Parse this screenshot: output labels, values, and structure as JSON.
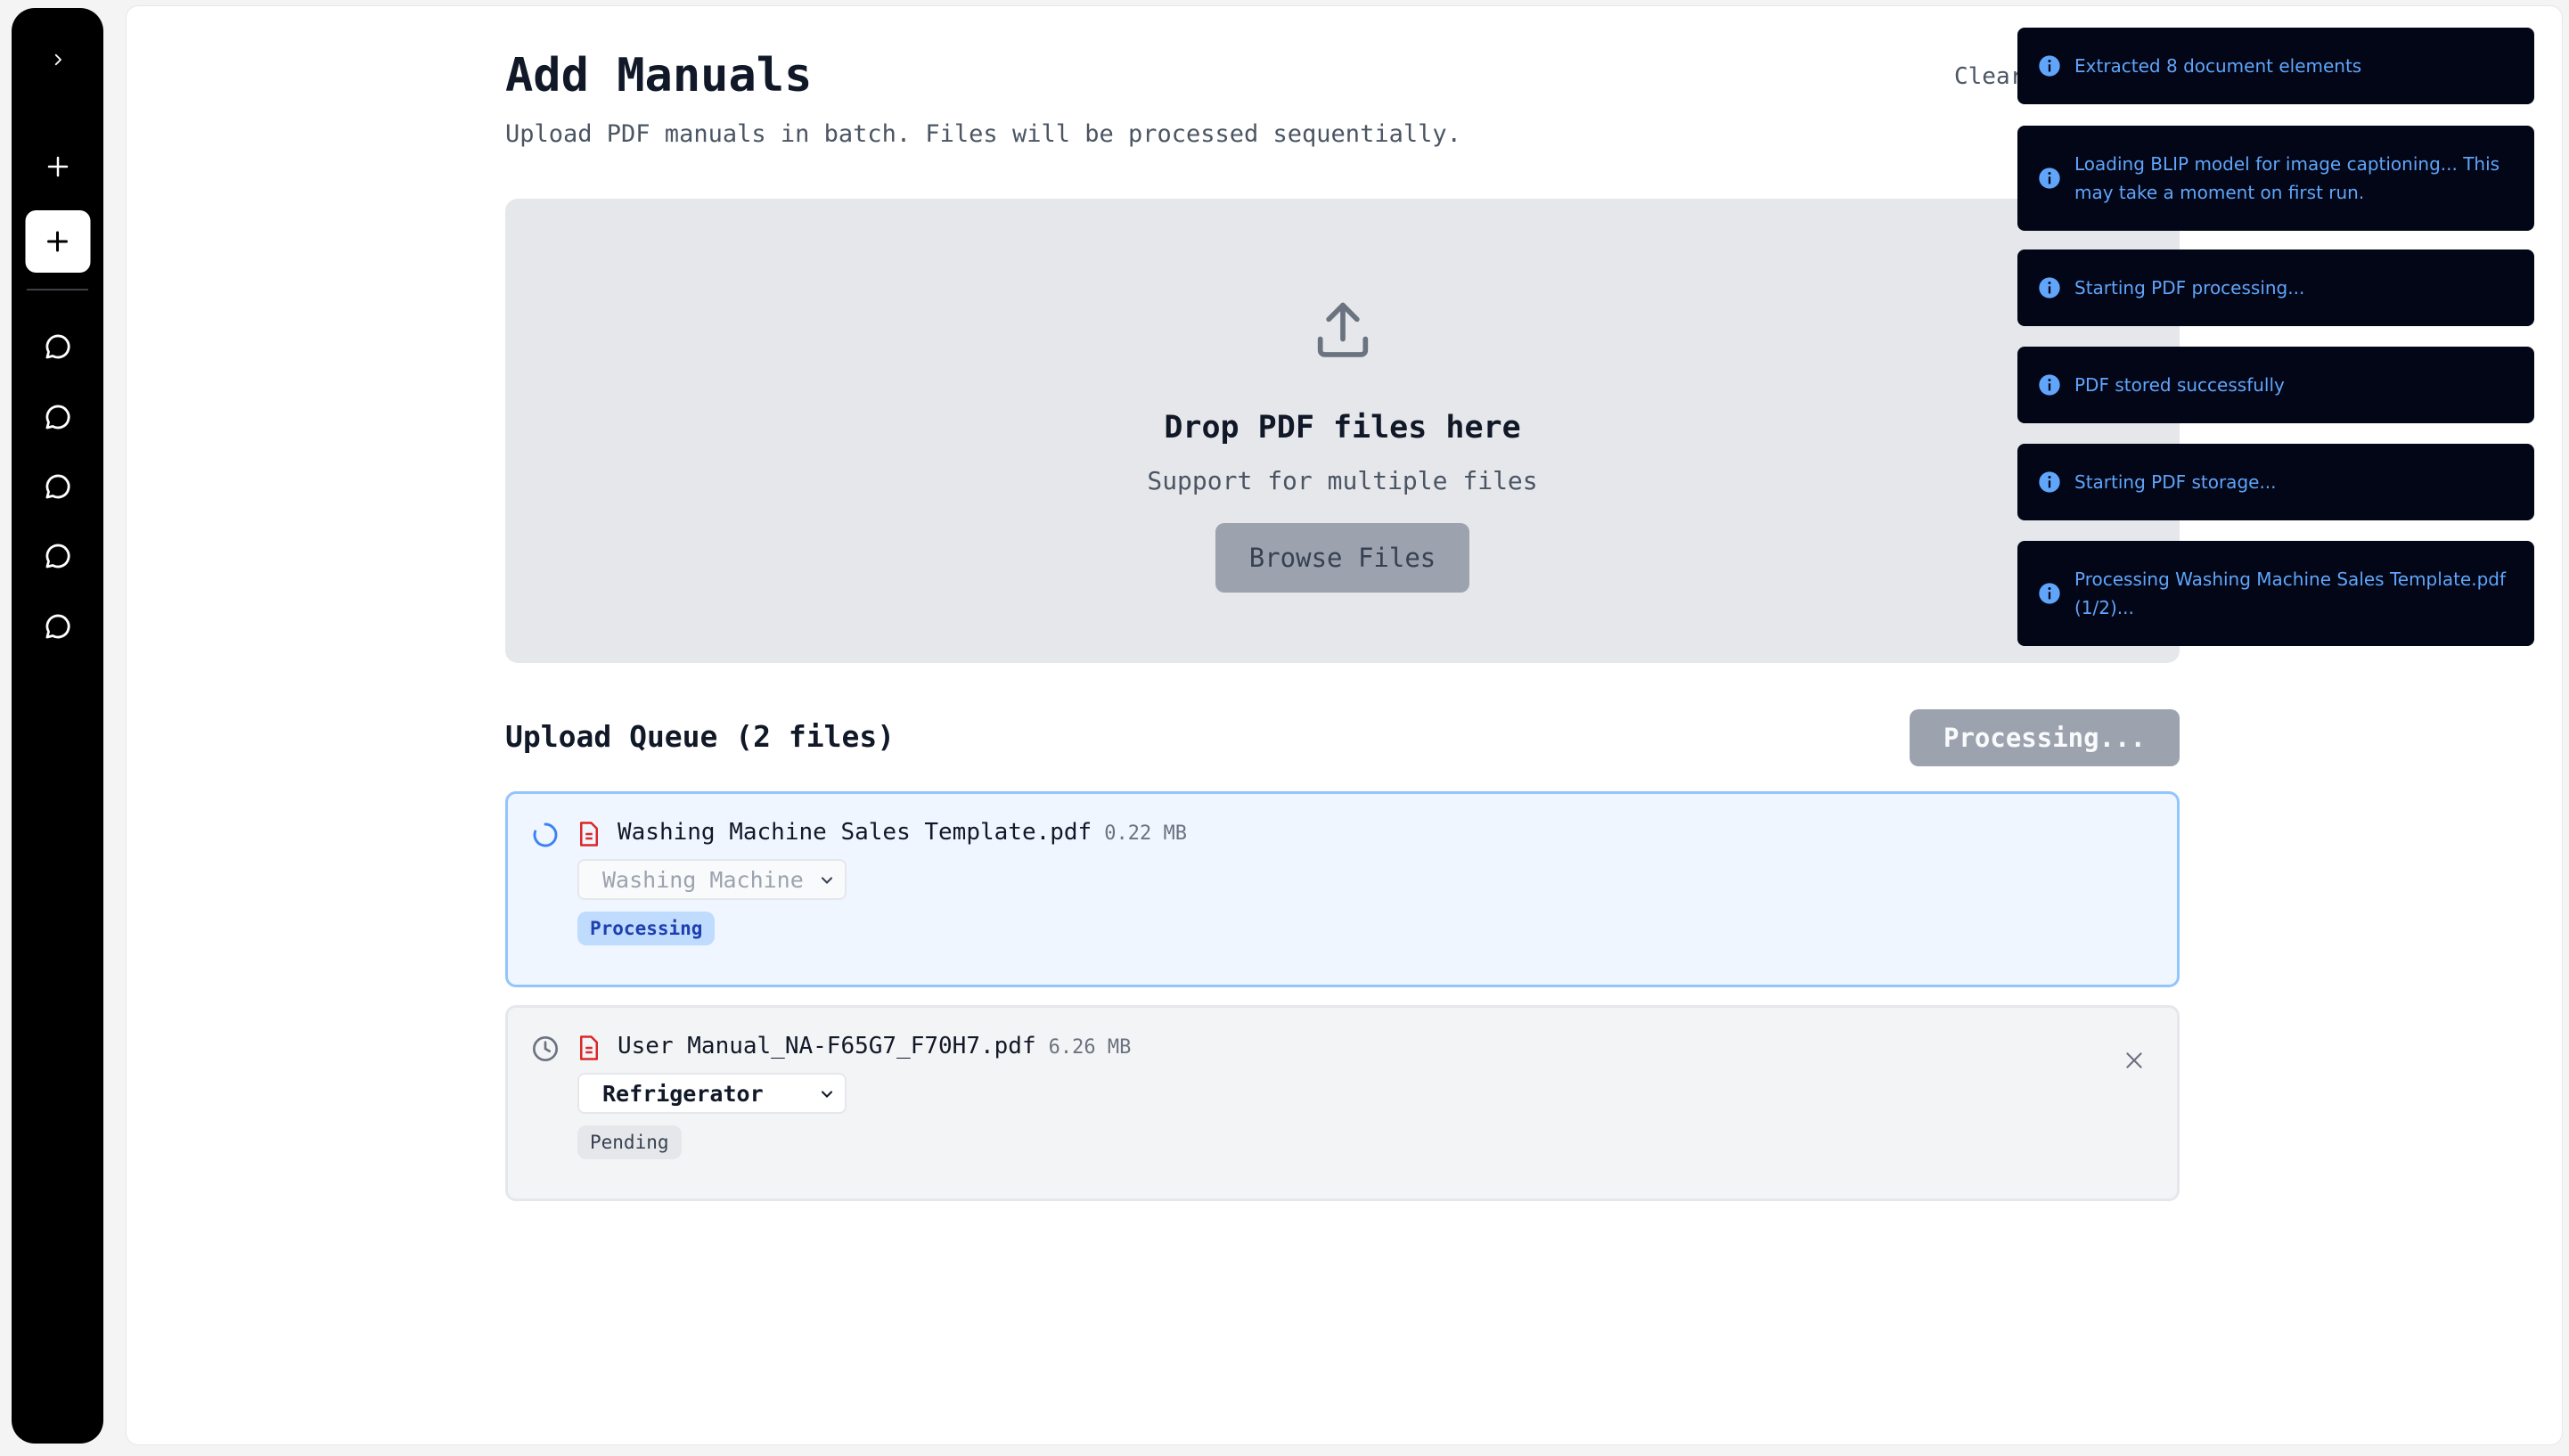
{
  "sidebar": {
    "expand_icon": "chevron-right-icon",
    "new_icon": "plus-icon",
    "new_chat_icon": "plus-icon",
    "chats": [
      {
        "icon": "chat-bubble-icon"
      },
      {
        "icon": "chat-bubble-icon"
      },
      {
        "icon": "chat-bubble-icon"
      },
      {
        "icon": "chat-bubble-icon"
      },
      {
        "icon": "chat-bubble-icon"
      }
    ]
  },
  "header": {
    "title": "Add Manuals",
    "subtitle": "Upload PDF manuals in batch. Files will be processed sequentially.",
    "clear_label": "Clear"
  },
  "dropzone": {
    "icon": "upload-icon",
    "title": "Drop PDF files here",
    "subtitle": "Support for multiple files",
    "browse_label": "Browse Files"
  },
  "queue": {
    "title": "Upload Queue (2 files)",
    "process_button_label": "Processing...",
    "items": [
      {
        "status_icon": "spinner-icon",
        "file_icon": "pdf-file-icon",
        "name": "Washing Machine Sales Template.pdf",
        "size": "0.22 MB",
        "category": "Washing Machine",
        "status": "Processing"
      },
      {
        "status_icon": "clock-icon",
        "file_icon": "pdf-file-icon",
        "name": "User Manual_NA-F65G7_F70H7.pdf",
        "size": "6.26 MB",
        "category": "Refrigerator",
        "status": "Pending"
      }
    ]
  },
  "toasts": [
    {
      "icon": "info-icon",
      "text": "Extracted 8 document elements"
    },
    {
      "icon": "info-icon",
      "text": "Loading BLIP model for image captioning... This may take a moment on first run."
    },
    {
      "icon": "info-icon",
      "text": "Starting PDF processing..."
    },
    {
      "icon": "info-icon",
      "text": "PDF stored successfully"
    },
    {
      "icon": "info-icon",
      "text": "Starting PDF storage..."
    },
    {
      "icon": "info-icon",
      "text": "Processing Washing Machine Sales Template.pdf (1/2)..."
    }
  ],
  "colors": {
    "sidebar_bg": "#000000",
    "toast_bg": "#020617",
    "toast_text": "#60a5fa",
    "active_border": "#93c5fd",
    "active_bg": "#eff6ff",
    "pdf_icon": "#dc2626"
  }
}
